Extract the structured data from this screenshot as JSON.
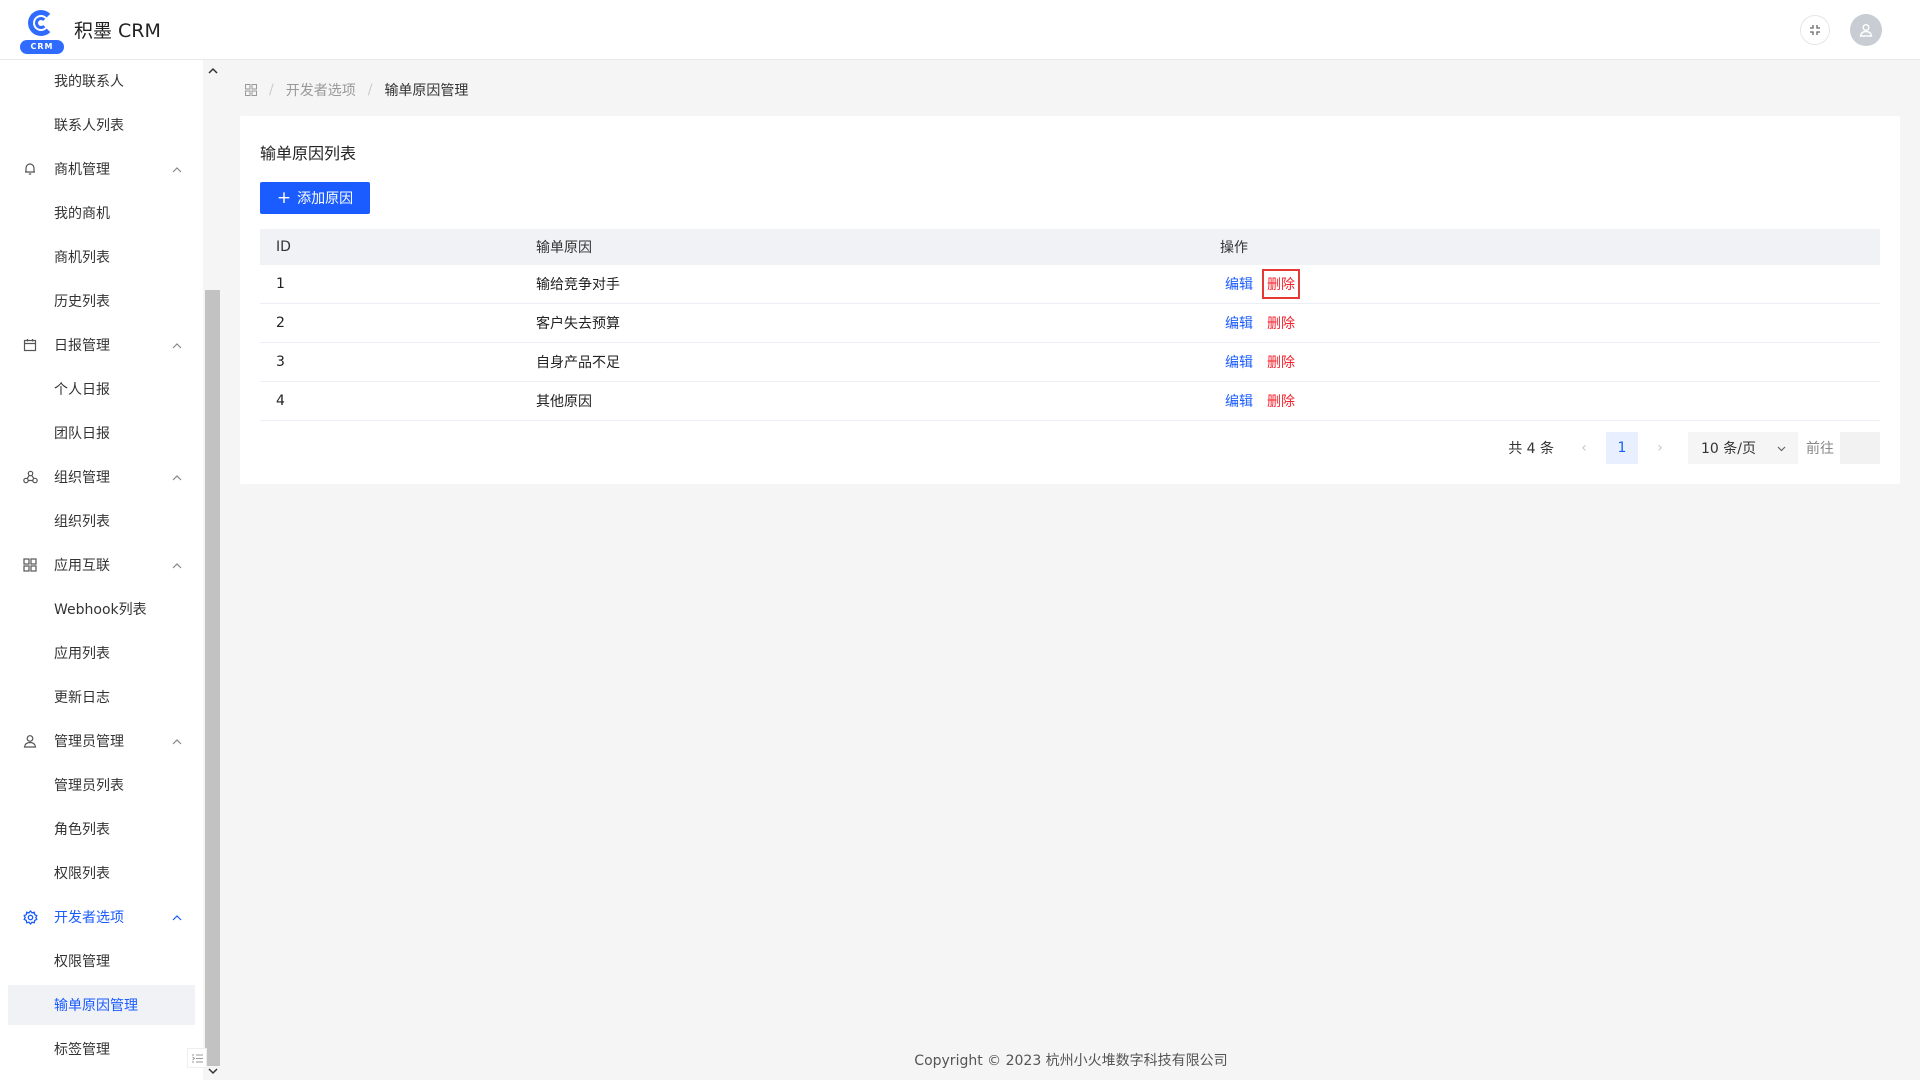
{
  "app": {
    "title": "积墨 CRM",
    "logo_badge": "CRM",
    "accent": "#1a5cff",
    "danger": "#f5222d"
  },
  "sidebar": {
    "items": [
      {
        "label": "我的联系人",
        "type": "sub"
      },
      {
        "label": "联系人列表",
        "type": "sub"
      },
      {
        "label": "商机管理",
        "type": "group",
        "icon": "bell-icon"
      },
      {
        "label": "我的商机",
        "type": "sub"
      },
      {
        "label": "商机列表",
        "type": "sub"
      },
      {
        "label": "历史列表",
        "type": "sub"
      },
      {
        "label": "日报管理",
        "type": "group",
        "icon": "calendar-icon"
      },
      {
        "label": "个人日报",
        "type": "sub"
      },
      {
        "label": "团队日报",
        "type": "sub"
      },
      {
        "label": "组织管理",
        "type": "group",
        "icon": "organization-icon"
      },
      {
        "label": "组织列表",
        "type": "sub"
      },
      {
        "label": "应用互联",
        "type": "group",
        "icon": "grid-icon"
      },
      {
        "label": "Webhook列表",
        "type": "sub"
      },
      {
        "label": "应用列表",
        "type": "sub"
      },
      {
        "label": "更新日志",
        "type": "sub"
      },
      {
        "label": "管理员管理",
        "type": "group",
        "icon": "user-icon"
      },
      {
        "label": "管理员列表",
        "type": "sub"
      },
      {
        "label": "角色列表",
        "type": "sub"
      },
      {
        "label": "权限列表",
        "type": "sub"
      },
      {
        "label": "开发者选项",
        "type": "group",
        "icon": "gear-icon",
        "active": true
      },
      {
        "label": "权限管理",
        "type": "sub"
      },
      {
        "label": "输单原因管理",
        "type": "sub",
        "active": true
      },
      {
        "label": "标签管理",
        "type": "sub"
      }
    ]
  },
  "breadcrumb": {
    "home_icon": "grid-home-icon",
    "level1": "开发者选项",
    "current": "输单原因管理"
  },
  "card": {
    "title": "输单原因列表",
    "add_button": "添加原因"
  },
  "table": {
    "columns": [
      "ID",
      "输单原因",
      "操作"
    ],
    "rows": [
      {
        "id": "1",
        "reason": "输给竞争对手",
        "edit": "编辑",
        "delete": "删除"
      },
      {
        "id": "2",
        "reason": "客户失去预算",
        "edit": "编辑",
        "delete": "删除"
      },
      {
        "id": "3",
        "reason": "自身产品不足",
        "edit": "编辑",
        "delete": "删除"
      },
      {
        "id": "4",
        "reason": "其他原因",
        "edit": "编辑",
        "delete": "删除"
      }
    ]
  },
  "pagination": {
    "total": "共 4 条",
    "current_page": "1",
    "page_size": "10 条/页",
    "goto_label": "前往"
  },
  "footer": {
    "copyright": "Copyright © 2023 杭州小火堆数字科技有限公司"
  }
}
